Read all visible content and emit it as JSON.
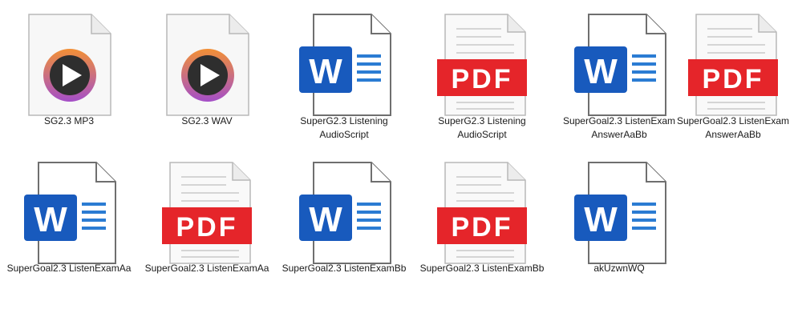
{
  "files": [
    {
      "name": "SG2.3 MP3",
      "icon": "media-file-icon",
      "type": "media"
    },
    {
      "name": "SG2.3 WAV",
      "icon": "media-file-icon",
      "type": "media"
    },
    {
      "name": "SuperG2.3 Listening AudioScript",
      "icon": "word-file-icon",
      "type": "word"
    },
    {
      "name": "SuperG2.3 Listening AudioScript",
      "icon": "pdf-file-icon",
      "type": "pdf"
    },
    {
      "name": "SuperGoal2.3 ListenExam AnswerAaBb",
      "icon": "word-file-icon",
      "type": "word"
    },
    {
      "name": "SuperGoal2.3 ListenExam AnswerAaBb",
      "icon": "pdf-file-icon",
      "type": "pdf"
    },
    {
      "name": "SuperGoal2.3 ListenExamAa",
      "icon": "word-file-icon",
      "type": "word"
    },
    {
      "name": "SuperGoal2.3 ListenExamAa",
      "icon": "pdf-file-icon",
      "type": "pdf"
    },
    {
      "name": "SuperGoal2.3 ListenExamBb",
      "icon": "word-file-icon",
      "type": "word"
    },
    {
      "name": "SuperGoal2.3 ListenExamBb",
      "icon": "pdf-file-icon",
      "type": "pdf"
    },
    {
      "name": "akUzwnWQ",
      "icon": "word-file-icon",
      "type": "word"
    }
  ],
  "badges": {
    "word": "W",
    "pdf": "PDF"
  },
  "colors": {
    "word_blue": "#185abd",
    "pdf_red": "#e5252a",
    "page_fill": "#ffffff",
    "page_stroke": "#7a7a7a",
    "media_ring_start": "#f08a3c",
    "media_ring_end": "#b14dc4",
    "media_center": "#333333"
  }
}
